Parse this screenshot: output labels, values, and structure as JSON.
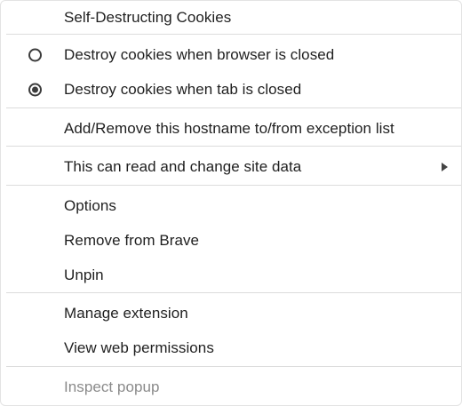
{
  "menu": {
    "title": "Self-Destructing Cookies",
    "radio_options": [
      {
        "label": "Destroy cookies when browser is closed",
        "checked": false
      },
      {
        "label": "Destroy cookies when tab is closed",
        "checked": true
      }
    ],
    "exception_item": "Add/Remove this hostname to/from exception list",
    "site_data_item": "This can read and change site data",
    "options_item": "Options",
    "remove_item": "Remove from Brave",
    "unpin_item": "Unpin",
    "manage_item": "Manage extension",
    "permissions_item": "View web permissions",
    "inspect_item": "Inspect popup",
    "submenu_icon": "chevron-right-icon"
  }
}
